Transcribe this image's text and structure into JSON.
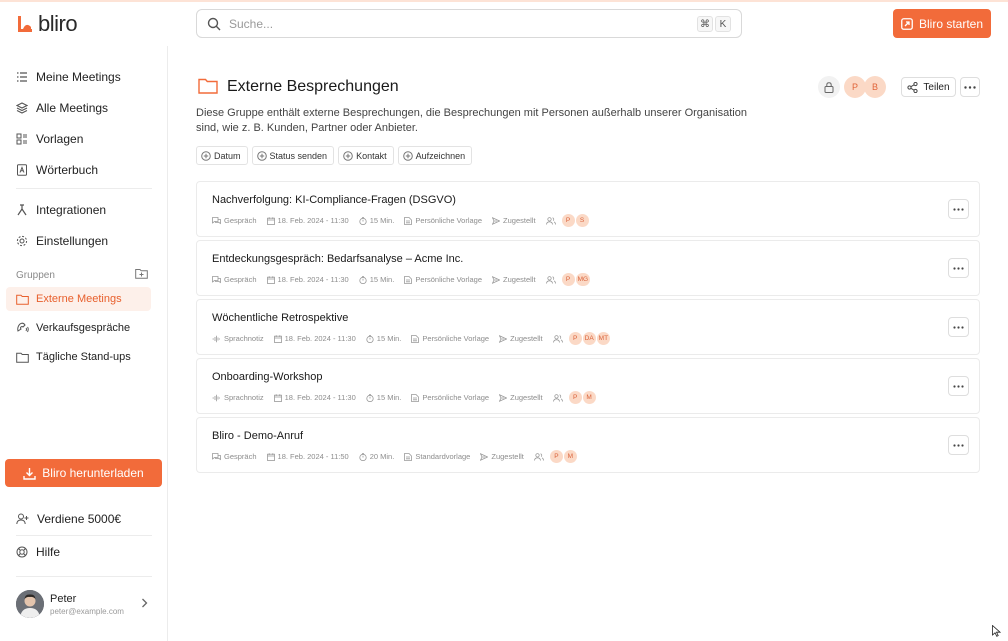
{
  "app": {
    "brand": "bliro"
  },
  "search": {
    "placeholder": "Suche...",
    "shortcut_key1": "⌘",
    "shortcut_key2": "K"
  },
  "topbar": {
    "start_label": "Bliro starten"
  },
  "colors": {
    "accent": "#f26b3a",
    "avatar_bg": "#fbd9c6",
    "avatar_text": "#d9623a",
    "active_bg": "#fdf0ea"
  },
  "sidebar": {
    "nav": [
      {
        "label": "Meine Meetings",
        "icon": "list-icon"
      },
      {
        "label": "Alle Meetings",
        "icon": "layers-icon"
      },
      {
        "label": "Vorlagen",
        "icon": "template-icon"
      },
      {
        "label": "Wörterbuch",
        "icon": "dictionary-icon"
      },
      {
        "label": "Integrationen",
        "icon": "integrations-icon"
      },
      {
        "label": "Einstellungen",
        "icon": "gear-icon"
      }
    ],
    "groups_label": "Gruppen",
    "groups": [
      {
        "label": "Externe Meetings",
        "icon": "folder-icon",
        "active": true
      },
      {
        "label": "Verkaufsgespräche",
        "icon": "sales-icon",
        "active": false
      },
      {
        "label": "Tägliche Stand-ups",
        "icon": "folder-icon",
        "active": false
      }
    ],
    "download_label": "Bliro herunterladen",
    "earn_label": "Verdiene 5000€",
    "help_label": "Hilfe",
    "user": {
      "name": "Peter",
      "email": "peter@example.com"
    }
  },
  "main": {
    "title": "Externe Besprechungen",
    "description": "Diese Gruppe enthält externe Besprechungen, die Besprechungen mit Personen außerhalb unserer Organisation sind, wie z. B. Kunden, Partner oder Anbieter.",
    "header_avatars": [
      "P",
      "B"
    ],
    "share_label": "Teilen",
    "filters": [
      "Datum",
      "Status senden",
      "Kontakt",
      "Aufzeichnen"
    ],
    "meetings": [
      {
        "title": "Nachverfolgung: KI-Compliance-Fragen (DSGVO)",
        "type": "Gespräch",
        "date": "18. Feb. 2024 - 11:30",
        "duration": "15 Min.",
        "template": "Persönliche Vorlage",
        "status": "Zugestellt",
        "participants": [
          "P",
          "S"
        ]
      },
      {
        "title": "Entdeckungsgespräch: Bedarfsanalyse – Acme Inc.",
        "type": "Gespräch",
        "date": "18. Feb. 2024 - 11:30",
        "duration": "15 Min.",
        "template": "Persönliche Vorlage",
        "status": "Zugestellt",
        "participants": [
          "P",
          "MG"
        ]
      },
      {
        "title": "Wöchentliche Retrospektive",
        "type": "Sprachnotiz",
        "date": "18. Feb. 2024 - 11:30",
        "duration": "15 Min.",
        "template": "Persönliche Vorlage",
        "status": "Zugestellt",
        "participants": [
          "P",
          "DA",
          "MT"
        ]
      },
      {
        "title": "Onboarding-Workshop",
        "type": "Sprachnotiz",
        "date": "18. Feb. 2024 - 11:30",
        "duration": "15 Min.",
        "template": "Persönliche Vorlage",
        "status": "Zugestellt",
        "participants": [
          "P",
          "M"
        ]
      },
      {
        "title": "Bliro - Demo-Anruf",
        "type": "Gespräch",
        "date": "18. Feb. 2024 - 11:50",
        "duration": "20 Min.",
        "template": "Standardvorlage",
        "status": "Zugestellt",
        "participants": [
          "P",
          "M"
        ]
      }
    ]
  }
}
